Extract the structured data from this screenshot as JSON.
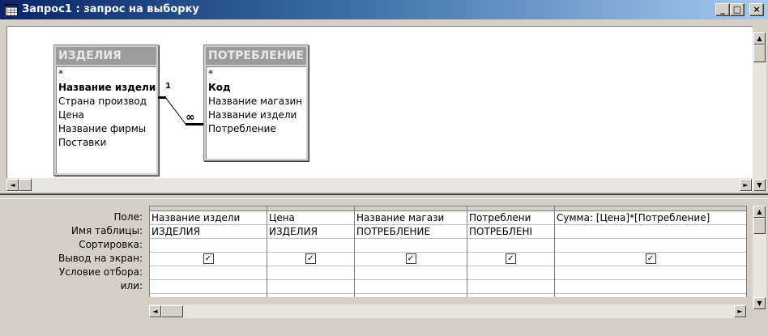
{
  "window": {
    "title": "Запрос1 : запрос на выборку",
    "minimize_glyph": "_",
    "restore_glyph": "□",
    "close_glyph": "×"
  },
  "tables": [
    {
      "name": "ИЗДЕЛИЯ",
      "fields": [
        "*",
        "Название издели",
        "Страна производ",
        "Цена",
        "Название фирмы",
        "Поставки"
      ],
      "key_field_index": 1
    },
    {
      "name": "ПОТРЕБЛЕНИЕ",
      "fields": [
        "*",
        "Код",
        "Название магазин",
        "Название издели",
        "Потребление"
      ],
      "key_field_index": 1
    }
  ],
  "relationship": {
    "one_side": "1",
    "many_side": "∞"
  },
  "grid": {
    "row_labels": [
      "Поле:",
      "Имя таблицы:",
      "Сортировка:",
      "Вывод на экран:",
      "Условие отбора:",
      "или:"
    ],
    "columns": [
      {
        "field": "Название издели",
        "table": "ИЗДЕЛИЯ",
        "sort": "",
        "show": true,
        "criteria": "",
        "or": ""
      },
      {
        "field": "Цена",
        "table": "ИЗДЕЛИЯ",
        "sort": "",
        "show": true,
        "criteria": "",
        "or": ""
      },
      {
        "field": "Название магази",
        "table": "ПОТРЕБЛЕНИЕ",
        "sort": "",
        "show": true,
        "criteria": "",
        "or": ""
      },
      {
        "field": "Потреблени",
        "table": "ПОТРЕБЛЕНІ",
        "sort": "",
        "show": true,
        "criteria": "",
        "or": ""
      },
      {
        "field": "Сумма: [Цена]*[Потребление]",
        "table": "",
        "sort": "",
        "show": true,
        "criteria": "",
        "or": ""
      }
    ]
  },
  "icons": {
    "app": "query-datasheet-icon",
    "scroll_up": "▲",
    "scroll_down": "▼",
    "scroll_left": "◄",
    "scroll_right": "►"
  }
}
